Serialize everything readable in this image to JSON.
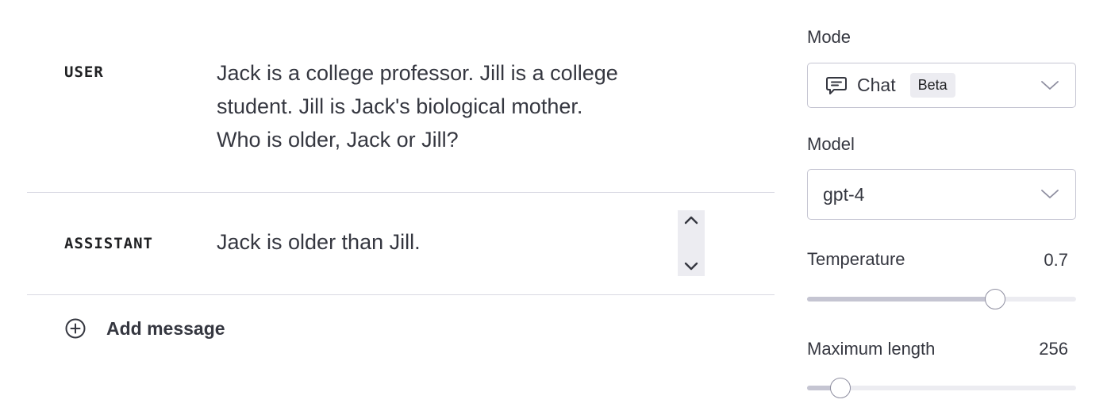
{
  "messages": [
    {
      "role": "USER",
      "content": "Jack is a college professor.  Jill is a college\nstudent.  Jill is Jack's biological mother.\nWho is older, Jack or Jill?"
    },
    {
      "role": "ASSISTANT",
      "content": "Jack is older than Jill."
    }
  ],
  "add_message": {
    "label": "Add message",
    "icon": "plus-circle-icon"
  },
  "settings": {
    "mode": {
      "label": "Mode",
      "value": "Chat",
      "badge": "Beta",
      "icon": "chat-bubble-icon"
    },
    "model": {
      "label": "Model",
      "value": "gpt-4"
    },
    "temperature": {
      "label": "Temperature",
      "value": "0.7",
      "fraction": 0.7
    },
    "maximum_length": {
      "label": "Maximum length",
      "value": "256",
      "fraction": 0.125
    }
  },
  "colors": {
    "border": "#d9d9e3",
    "text": "#353740",
    "slider_fill": "#c5c5d2",
    "slider_track": "#ececf1"
  }
}
